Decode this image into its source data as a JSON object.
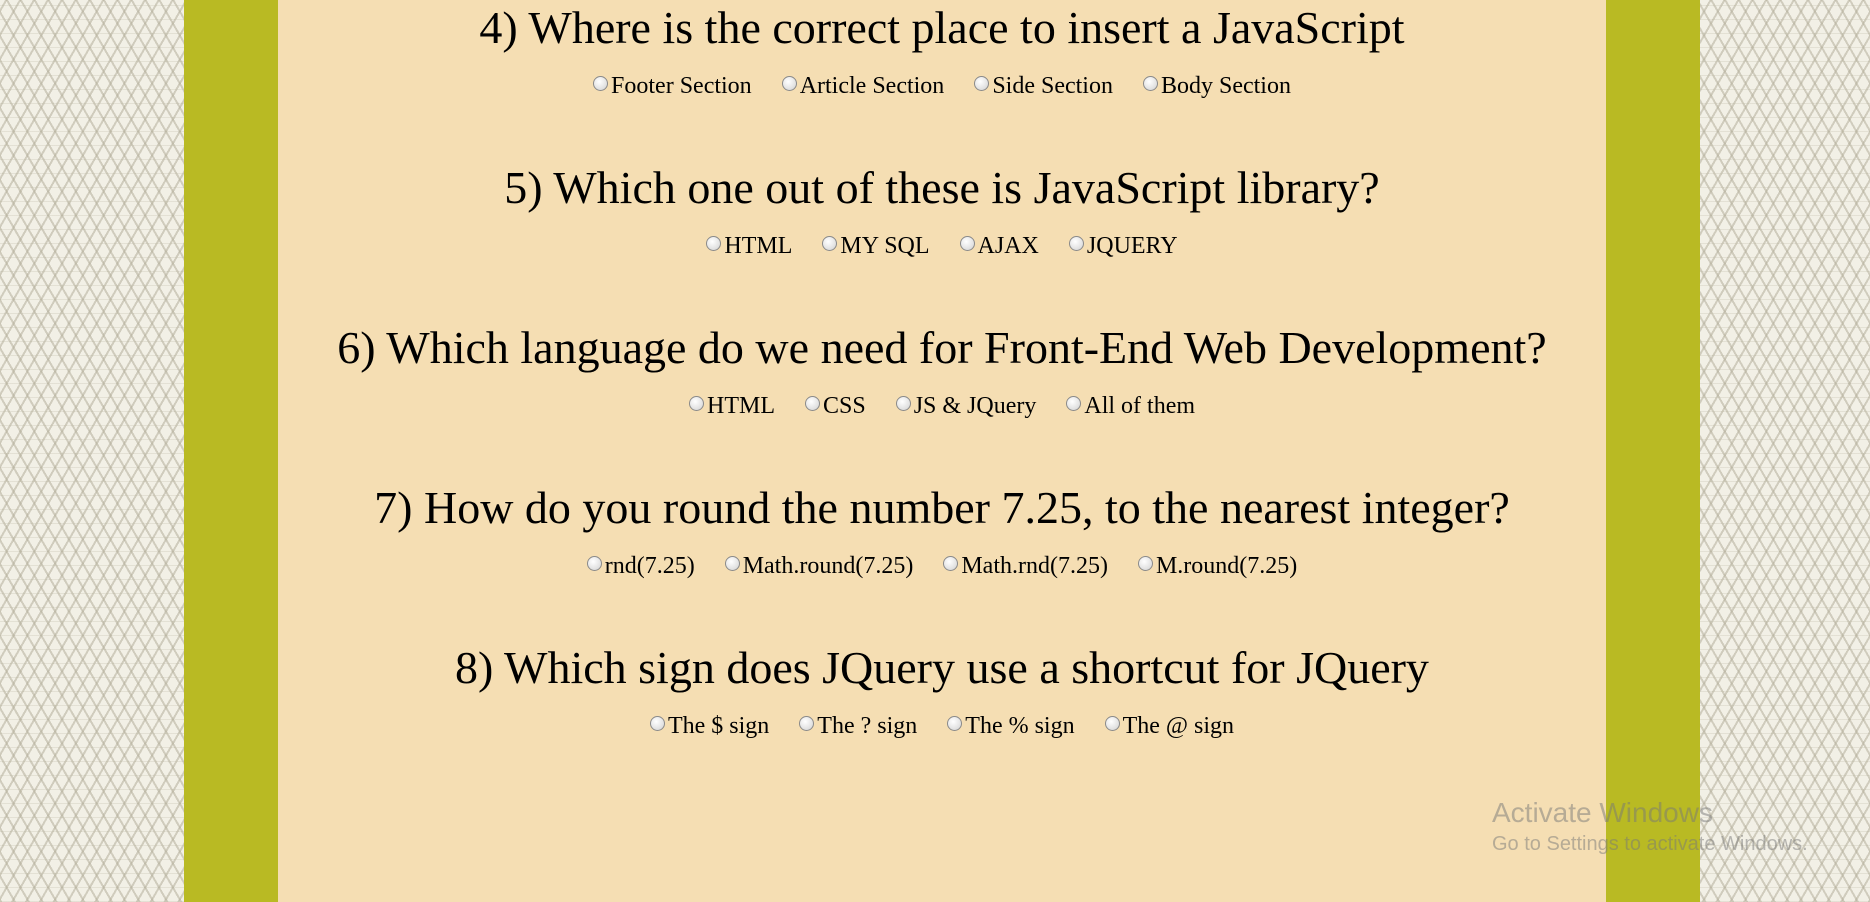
{
  "questions": [
    {
      "text": "4) Where is the correct place to insert a JavaScript",
      "options": [
        "Footer Section",
        "Article Section",
        "Side Section",
        "Body Section"
      ]
    },
    {
      "text": "5) Which one out of these is JavaScript library?",
      "options": [
        "HTML",
        "MY SQL",
        "AJAX",
        "JQUERY"
      ]
    },
    {
      "text": "6) Which language do we need for Front-End Web Development?",
      "options": [
        "HTML",
        "CSS",
        "JS & JQuery",
        "All of them"
      ]
    },
    {
      "text": "7) How do you round the number 7.25, to the nearest integer?",
      "options": [
        "rnd(7.25)",
        "Math.round(7.25)",
        "Math.rnd(7.25)",
        "M.round(7.25)"
      ]
    },
    {
      "text": "8) Which sign does JQuery use a shortcut for JQuery",
      "options": [
        "The $ sign",
        "The ? sign",
        "The % sign",
        "The @ sign"
      ]
    }
  ],
  "watermark": {
    "title": "Activate Windows",
    "subtitle": "Go to Settings to activate Windows."
  },
  "colors": {
    "band": "#b9ba23",
    "panel": "#f5deb3"
  }
}
